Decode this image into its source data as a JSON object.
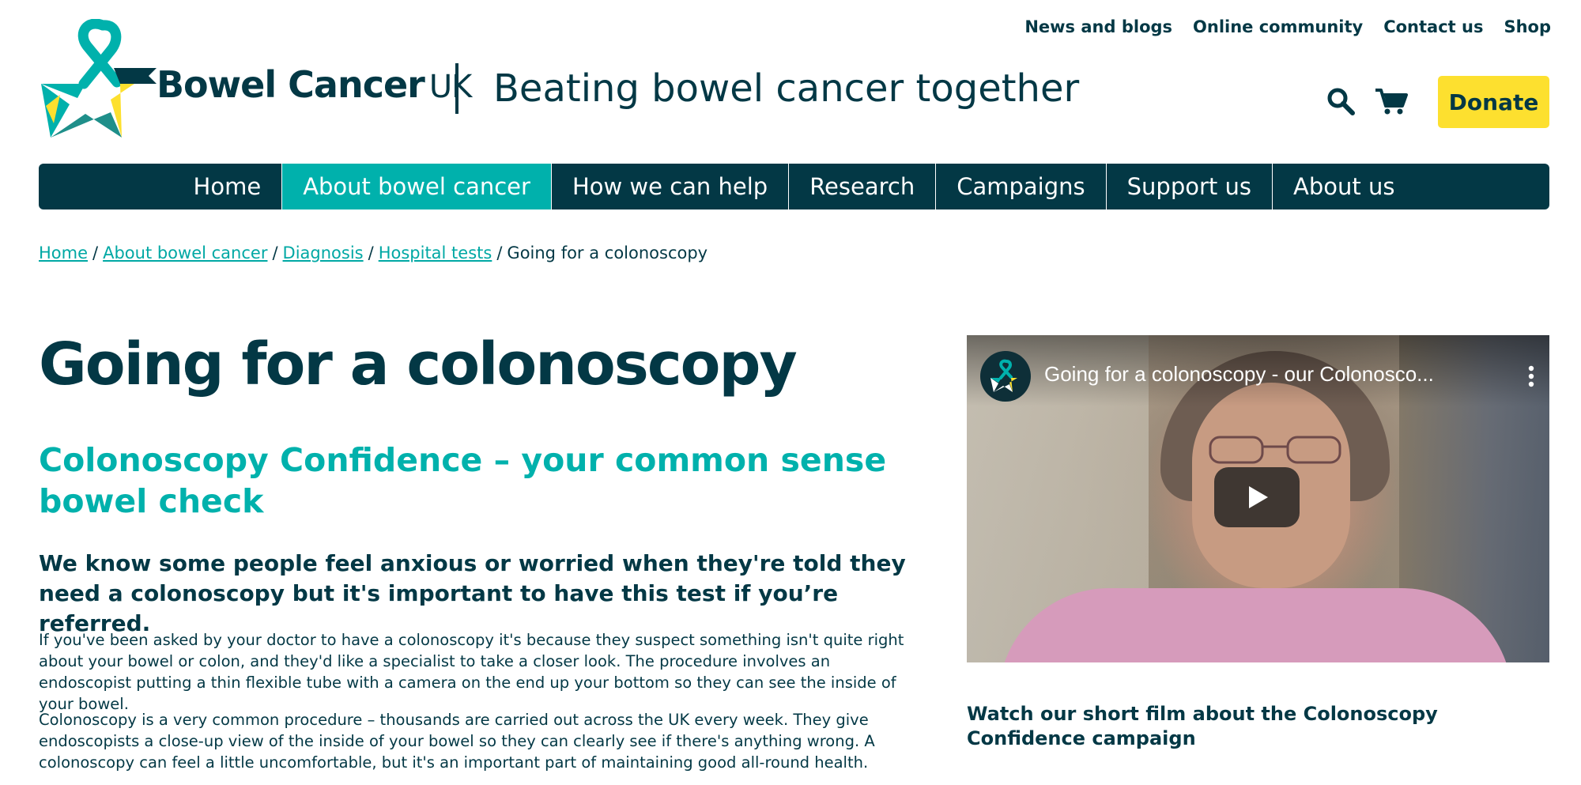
{
  "header": {
    "logo_text": "Bowel Cancer",
    "logo_suffix": "UK",
    "tagline": "Beating bowel cancer together",
    "top_links": [
      "News and blogs",
      "Online community",
      "Contact us",
      "Shop"
    ],
    "donate_label": "Donate",
    "icons": {
      "search": "search-icon",
      "cart": "cart-icon"
    }
  },
  "nav": {
    "items": [
      "Home",
      "About bowel cancer",
      "How we can help",
      "Research",
      "Campaigns",
      "Support us",
      "About us"
    ],
    "active": "About bowel cancer"
  },
  "breadcrumb": {
    "links": [
      "Home",
      "About bowel cancer",
      "Diagnosis",
      "Hospital tests"
    ],
    "separator": "/",
    "current": "Going for a colonoscopy"
  },
  "main": {
    "title": "Going for a colonoscopy",
    "subtitle": "Colonoscopy Confidence – your common sense bowel check",
    "lead": "We know some people feel anxious or worried when they're told they need a colonoscopy but it's important to have this test if you’re referred.",
    "paragraphs": [
      "If you've been asked by your doctor to have a colonoscopy it's because they suspect something isn't quite right about your bowel or colon, and they'd like a specialist to take a closer look. The procedure involves an endoscopist putting a thin flexible tube with a camera on the end up your bottom so they can see the inside of your bowel.",
      "Colonoscopy is a very common procedure – thousands are carried out across the UK every week. They give endoscopists a close-up view of the inside of your bowel so they can clearly see if there's anything wrong. A colonoscopy can feel a little uncomfortable, but it's an important part of maintaining good all-round health."
    ]
  },
  "video": {
    "title": "Going for a colonoscopy - our Colonosco...",
    "caption": "Watch our short film about the Colonoscopy Confidence campaign"
  },
  "colors": {
    "navy": "#033845",
    "teal": "#00b1ac",
    "yellow": "#fde02f",
    "link": "#00a8a4"
  }
}
